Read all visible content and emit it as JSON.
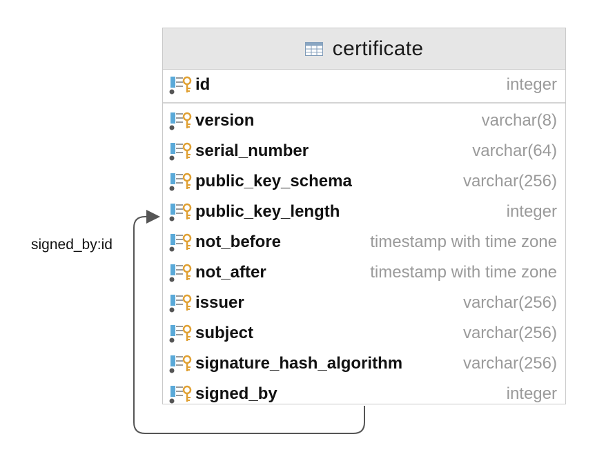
{
  "table": {
    "name": "certificate",
    "primary_key": {
      "name": "id",
      "type": "integer"
    },
    "columns": [
      {
        "name": "version",
        "type": "varchar(8)"
      },
      {
        "name": "serial_number",
        "type": "varchar(64)"
      },
      {
        "name": "public_key_schema",
        "type": "varchar(256)"
      },
      {
        "name": "public_key_length",
        "type": "integer"
      },
      {
        "name": "not_before",
        "type": "timestamp with time zone"
      },
      {
        "name": "not_after",
        "type": "timestamp with time zone"
      },
      {
        "name": "issuer",
        "type": "varchar(256)"
      },
      {
        "name": "subject",
        "type": "varchar(256)"
      },
      {
        "name": "signature_hash_algorithm",
        "type": "varchar(256)"
      },
      {
        "name": "signed_by",
        "type": "integer"
      }
    ]
  },
  "relationship": {
    "label": "signed_by:id"
  },
  "icons": {
    "table": "table-grid-icon",
    "column": "column-key-icon"
  },
  "colors": {
    "header_bg": "#e6e6e6",
    "key_gold": "#e0a032",
    "column_blue": "#5aa9d8",
    "type_gray": "#9a9a9a",
    "connector": "#555555"
  }
}
